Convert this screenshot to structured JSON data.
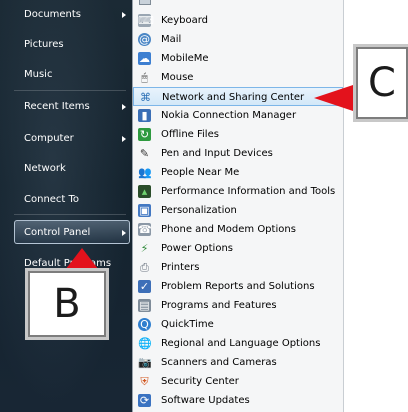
{
  "start_menu_left": {
    "items": [
      {
        "label": "Documents",
        "has_arrow": true
      },
      {
        "label": "Pictures",
        "has_arrow": false
      },
      {
        "label": "Music",
        "has_arrow": false
      },
      {
        "label": "Recent Items",
        "has_arrow": true
      },
      {
        "label": "Computer",
        "has_arrow": true
      },
      {
        "label": "Network",
        "has_arrow": false
      },
      {
        "label": "Connect To",
        "has_arrow": false
      },
      {
        "label": "Control Panel",
        "has_arrow": true
      },
      {
        "label": "Default Programs",
        "has_arrow": false
      }
    ]
  },
  "control_panel_menu": {
    "items": [
      {
        "label": "Keyboard",
        "icon": "keyboard-icon"
      },
      {
        "label": "Mail",
        "icon": "mail-icon"
      },
      {
        "label": "MobileMe",
        "icon": "mobileme-icon"
      },
      {
        "label": "Mouse",
        "icon": "mouse-icon"
      },
      {
        "label": "Network and Sharing Center",
        "icon": "network-icon",
        "selected": true
      },
      {
        "label": "Nokia Connection Manager",
        "icon": "nokia-icon"
      },
      {
        "label": "Offline Files",
        "icon": "offline-files-icon"
      },
      {
        "label": "Pen and Input Devices",
        "icon": "pen-icon"
      },
      {
        "label": "People Near Me",
        "icon": "people-icon"
      },
      {
        "label": "Performance Information and Tools",
        "icon": "performance-icon"
      },
      {
        "label": "Personalization",
        "icon": "personalization-icon"
      },
      {
        "label": "Phone and Modem Options",
        "icon": "phone-icon"
      },
      {
        "label": "Power Options",
        "icon": "power-icon"
      },
      {
        "label": "Printers",
        "icon": "printer-icon"
      },
      {
        "label": "Problem Reports and Solutions",
        "icon": "problem-reports-icon"
      },
      {
        "label": "Programs and Features",
        "icon": "programs-icon"
      },
      {
        "label": "QuickTime",
        "icon": "quicktime-icon"
      },
      {
        "label": "Regional and Language Options",
        "icon": "globe-icon"
      },
      {
        "label": "Scanners and Cameras",
        "icon": "scanner-icon"
      },
      {
        "label": "Security Center",
        "icon": "shield-icon"
      },
      {
        "label": "Software Updates",
        "icon": "software-updates-icon"
      }
    ]
  },
  "annotations": {
    "callout_b": "B",
    "callout_c": "C",
    "arrow_color": "#e3121c"
  }
}
